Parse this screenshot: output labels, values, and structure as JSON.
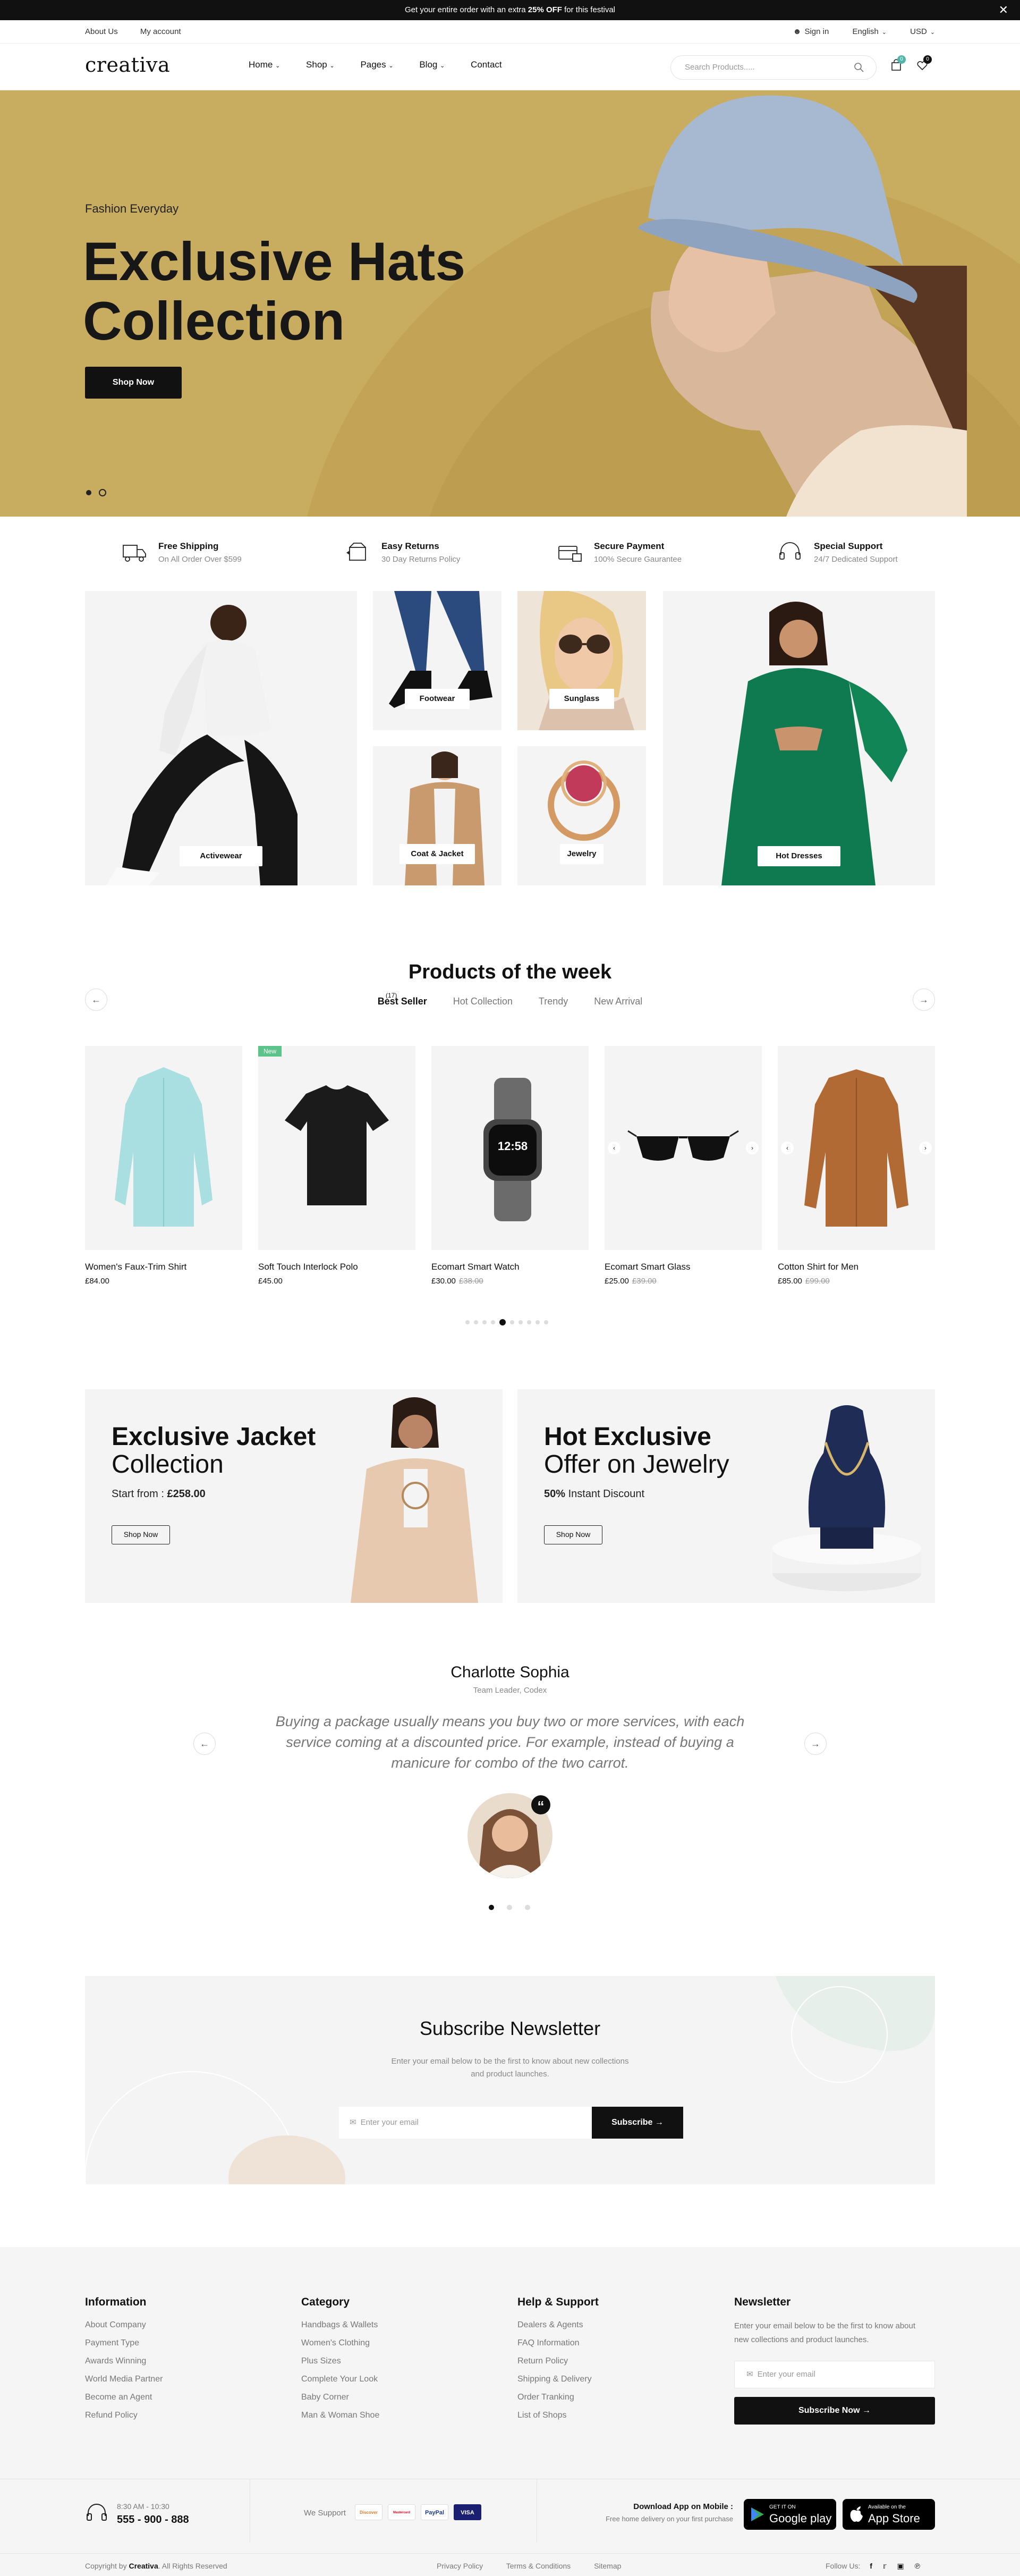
{
  "announcement": {
    "before": "Get your entire order with an extra ",
    "bold": "25% OFF",
    "after": " for this festival"
  },
  "util": {
    "about": "About Us",
    "account": "My account",
    "signin": "Sign in",
    "language": "English",
    "currency": "USD"
  },
  "header": {
    "logo": "creativa",
    "nav": [
      "Home",
      "Shop",
      "Pages",
      "Blog",
      "Contact"
    ],
    "search_placeholder": "Search Products.....",
    "cart_count": "0",
    "wishlist_count": "0"
  },
  "hero": {
    "kicker": "Fashion Everyday",
    "title_line1": "Exclusive Hats",
    "title_line2": "Collection",
    "button": "Shop Now",
    "bg_color": "#c8ac5f"
  },
  "features": [
    {
      "title": "Free Shipping",
      "sub": "On All Order Over $599"
    },
    {
      "title": "Easy Returns",
      "sub": "30 Day Returns Policy"
    },
    {
      "title": "Secure Payment",
      "sub": "100% Secure Gaurantee"
    },
    {
      "title": "Special Support",
      "sub": "24/7 Dedicated Support"
    }
  ],
  "categories": [
    "Activewear",
    "Footwear",
    "Sunglass",
    "Coat & Jacket",
    "Jewelry",
    "Hot Dresses"
  ],
  "products_section": {
    "title": "Products of the week",
    "tabs": [
      "Best Seller",
      "Hot Collection",
      "Trendy",
      "New Arrival"
    ],
    "tab_badge": "(17)",
    "new_badge": "New",
    "products": [
      {
        "name": "Women's Faux-Trim Shirt",
        "price": "£84.00",
        "old": ""
      },
      {
        "name": "Soft Touch Interlock Polo",
        "price": "£45.00",
        "old": ""
      },
      {
        "name": "Ecomart Smart Watch",
        "price": "£30.00",
        "old": "£38.00"
      },
      {
        "name": "Ecomart Smart Glass",
        "price": "£25.00",
        "old": "£39.00"
      },
      {
        "name": "Cotton Shirt for Men",
        "price": "£85.00",
        "old": "£99.00"
      }
    ],
    "watch_time": "12:58"
  },
  "promos": [
    {
      "line1": "Exclusive Jacket",
      "line2": "Collection",
      "sub_prefix": "Start from : ",
      "sub_value": "£258.00",
      "button": "Shop Now"
    },
    {
      "line1": "Hot Exclusive",
      "line2": "Offer on Jewelry",
      "sub_prefix": " Instant Discount",
      "sub_value": "50%",
      "button": "Shop Now"
    }
  ],
  "testimonial": {
    "name": "Charlotte Sophia",
    "role": "Team Leader, Codex",
    "quote": "Buying a package usually means you buy two or more services, with each service coming at a discounted price. For example, instead of buying a manicure for combo of the two carrot."
  },
  "newsletter": {
    "title": "Subscribe Newsletter",
    "text1": "Enter your email below to be the first to know about new collections",
    "text2": "and product launches.",
    "placeholder": "Enter your email",
    "button": "Subscribe"
  },
  "footer": {
    "cols": [
      {
        "title": "Information",
        "links": [
          "About Company",
          "Payment Type",
          "Awards Winning",
          "World Media Partner",
          "Become an Agent",
          "Refund Policy"
        ]
      },
      {
        "title": "Category",
        "links": [
          "Handbags & Wallets",
          "Women's Clothing",
          "Plus Sizes",
          "Complete Your Look",
          "Baby Corner",
          "Man & Woman Shoe"
        ]
      },
      {
        "title": "Help & Support",
        "links": [
          "Dealers & Agents",
          "FAQ Information",
          "Return Policy",
          "Shipping & Delivery",
          "Order Tranking",
          "List of Shops"
        ]
      }
    ],
    "newsletter_title": "Newsletter",
    "newsletter_text1": "Enter your email below to be the first to know about",
    "newsletter_text2": "new collections and product launches.",
    "newsletter_placeholder": "Enter your email",
    "newsletter_button": "Subscribe Now",
    "hours": "8:30 AM - 10:30",
    "phone": "555 - 900 - 888",
    "we_support": "We Support",
    "payments": [
      "Discover",
      "Mastercard",
      "PayPal",
      "VISA"
    ],
    "app_title": "Download App on Mobile :",
    "app_sub": "Free home delivery on your first purchase",
    "gplay_small": "GET IT ON",
    "gplay_big": "Google play",
    "apple_small": "Available on the",
    "apple_big": "App Store",
    "copyright_prefix": "Copyright by ",
    "copyright_brand": "Creativa",
    "copyright_suffix": ". All Rights Reserved",
    "bottom_links": [
      "Privacy Policy",
      "Terms & Conditions",
      "Sitemap"
    ],
    "follow": "Follow Us:",
    "social_icons": [
      "facebook-icon",
      "twitter-icon",
      "instagram-icon",
      "pinterest-icon"
    ]
  },
  "colors": {
    "accent": "#111111",
    "badge": "#4fb6a8",
    "new_badge": "#5cc48a",
    "footer_bg": "#f5f5f5"
  }
}
